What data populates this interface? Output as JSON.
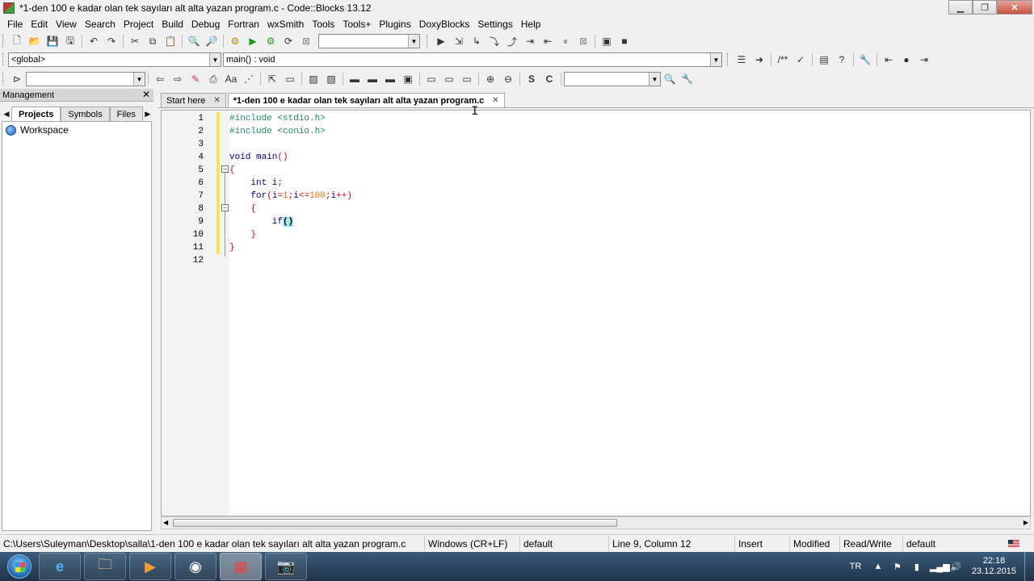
{
  "window": {
    "title": "*1-den 100 e kadar olan tek sayıları alt alta yazan program.c - Code::Blocks 13.12",
    "minimize": "▁",
    "maximize": "❐",
    "close": "✕"
  },
  "menu": [
    "File",
    "Edit",
    "View",
    "Search",
    "Project",
    "Build",
    "Debug",
    "Fortran",
    "wxSmith",
    "Tools",
    "Tools+",
    "Plugins",
    "DoxyBlocks",
    "Settings",
    "Help"
  ],
  "toolbar2": {
    "scope": "<global>",
    "function": "main() : void"
  },
  "management": {
    "header": "Management",
    "tabs": [
      "Projects",
      "Symbols",
      "Files"
    ],
    "workspace": "Workspace"
  },
  "editor": {
    "tabs": [
      {
        "label": "Start here"
      },
      {
        "label": "*1-den 100 e kadar olan tek sayıları alt alta yazan program.c"
      }
    ],
    "line_numbers": [
      "1",
      "2",
      "3",
      "4",
      "5",
      "6",
      "7",
      "8",
      "9",
      "10",
      "11",
      "12"
    ],
    "lines": [
      {
        "num": "1",
        "parts": [
          {
            "t": "#include <stdio.h>",
            "c": "pp"
          }
        ]
      },
      {
        "num": "2",
        "parts": [
          {
            "t": "#include <conio.h>",
            "c": "pp"
          }
        ]
      },
      {
        "num": "3",
        "parts": []
      },
      {
        "num": "4",
        "parts": [
          {
            "t": "void main",
            "c": "kw"
          },
          {
            "t": "()",
            "c": "op"
          }
        ]
      },
      {
        "num": "5",
        "parts": [
          {
            "t": "{",
            "c": "op"
          }
        ]
      },
      {
        "num": "6",
        "parts": [
          {
            "t": "    int i",
            "c": "kw"
          },
          {
            "t": ";",
            "c": "op"
          }
        ]
      },
      {
        "num": "7",
        "parts": [
          {
            "t": "    for",
            "c": "kw"
          },
          {
            "t": "(",
            "c": "op"
          },
          {
            "t": "i",
            "c": "kw"
          },
          {
            "t": "=",
            "c": "op"
          },
          {
            "t": "1",
            "c": "num"
          },
          {
            "t": ";",
            "c": "op"
          },
          {
            "t": "i",
            "c": "kw"
          },
          {
            "t": "<=",
            "c": "op"
          },
          {
            "t": "100",
            "c": "num"
          },
          {
            "t": ";",
            "c": "op"
          },
          {
            "t": "i",
            "c": "kw"
          },
          {
            "t": "++)",
            "c": "op"
          }
        ]
      },
      {
        "num": "8",
        "parts": [
          {
            "t": "    {",
            "c": "op"
          }
        ]
      },
      {
        "num": "9",
        "parts": [
          {
            "t": "        if",
            "c": "kw"
          },
          {
            "t": "()",
            "c": "hl"
          }
        ]
      },
      {
        "num": "10",
        "parts": [
          {
            "t": "    }",
            "c": "op"
          }
        ]
      },
      {
        "num": "11",
        "parts": [
          {
            "t": "}",
            "c": "op"
          }
        ]
      },
      {
        "num": "12",
        "parts": []
      }
    ]
  },
  "statusbar": {
    "path": "C:\\Users\\Suleyman\\Desktop\\salla\\1-den 100 e kadar olan tek sayıları alt alta yazan program.c",
    "eol": "Windows (CR+LF)",
    "encoding": "default",
    "position": "Line 9, Column 12",
    "mode": "Insert",
    "modified": "Modified",
    "access": "Read/Write",
    "lang": "default"
  },
  "taskbar": {
    "items": [
      "ie-icon",
      "explorer-icon",
      "media-player-icon",
      "chrome-icon",
      "codeblocks-icon",
      "camera-icon"
    ],
    "language": "TR",
    "time": "22:18",
    "date": "23.12.2015"
  }
}
